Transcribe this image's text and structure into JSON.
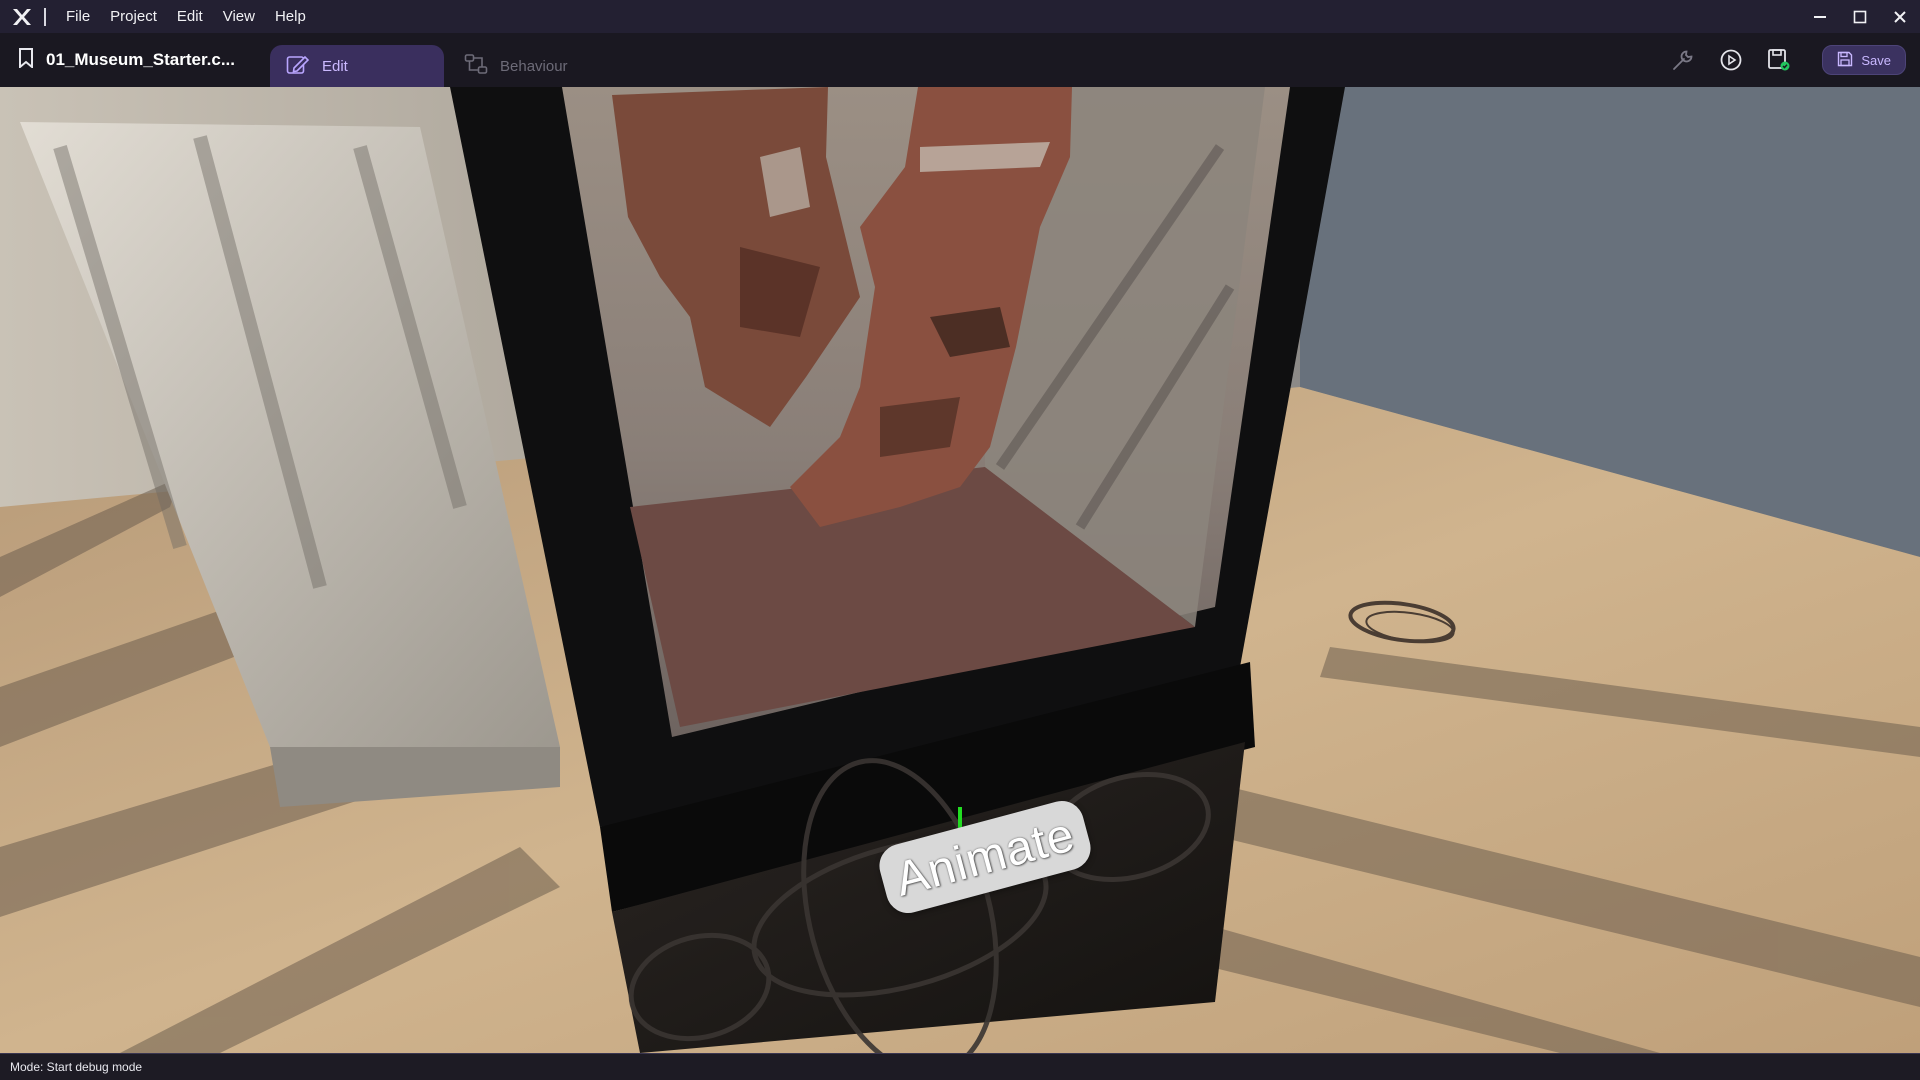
{
  "menubar": {
    "items": [
      "File",
      "Project",
      "Edit",
      "View",
      "Help"
    ]
  },
  "toolbar": {
    "document_title": "01_Museum_Starter.c...",
    "tabs": [
      {
        "label": "Edit",
        "active": true
      },
      {
        "label": "Behaviour",
        "active": false
      }
    ],
    "save_label": "Save",
    "icons": [
      "wrench-icon",
      "play-icon",
      "save-build-icon"
    ]
  },
  "viewport": {
    "button_label": "Animate"
  },
  "statusbar": {
    "text": "Mode: Start debug mode"
  },
  "colors": {
    "accent": "#3b3260",
    "accent_text": "#c9b8ff",
    "menubar_bg": "#232032",
    "toolbar_bg": "#1a1821",
    "selection_gizmo": "#22dd22"
  }
}
